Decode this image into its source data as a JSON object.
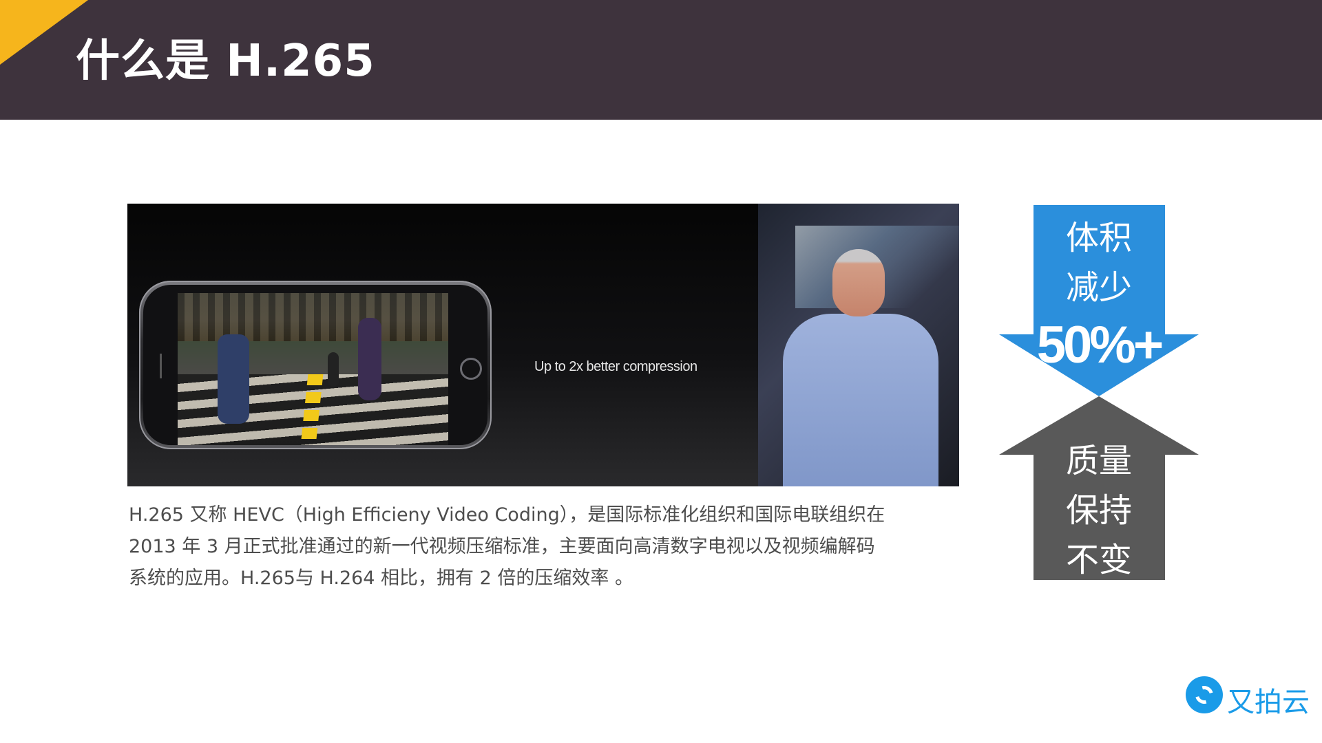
{
  "slide": {
    "title": "什么是 H.265",
    "accent_color": "#f6b51c",
    "header_color": "#3e333d"
  },
  "media": {
    "caption_text": "Up to 2x better compression"
  },
  "paragraph": {
    "lines": [
      "H.265 又称 HEVC（High Efficieny Video Coding），是国际标准化组织和国际电联组织在",
      "2013 年 3 月正式批准通过的新一代视频压缩标准，主要面向高清数字电视以及视频编解码",
      "系统的应用。H.265与 H.264 相比，拥有 2 倍的压缩效率 。"
    ]
  },
  "arrows": {
    "down": {
      "color": "#2b8fdc",
      "label_line1": "体积",
      "label_line2": "减少",
      "big_value": "50%+"
    },
    "up": {
      "color": "#595959",
      "label_line1": "质量",
      "label_line2": "保持",
      "label_line3": "不变"
    }
  },
  "logo": {
    "text": "又拍云",
    "color": "#1a9be8",
    "icon": "upyun-logo-icon"
  }
}
